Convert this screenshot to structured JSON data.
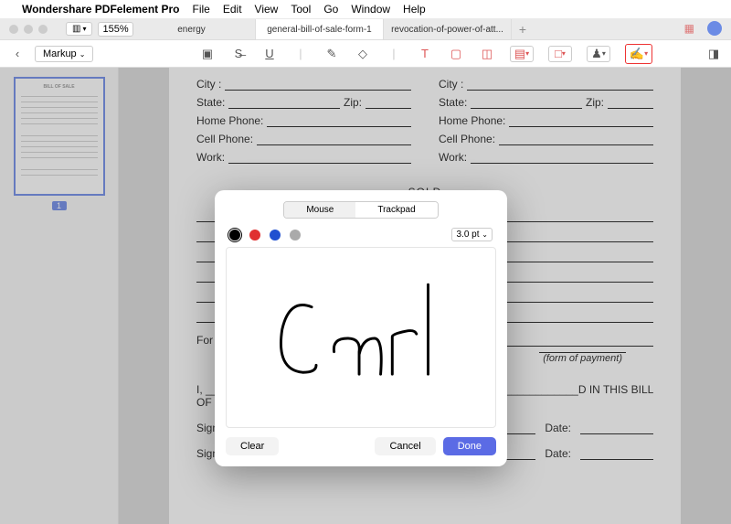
{
  "menubar": {
    "app": "Wondershare PDFelement Pro",
    "items": [
      "File",
      "Edit",
      "View",
      "Tool",
      "Go",
      "Window",
      "Help"
    ]
  },
  "titlebar": {
    "zoom": "155%"
  },
  "tabs": {
    "items": [
      "energy",
      "general-bill-of-sale-form-1",
      "revocation-of-power-of-att..."
    ],
    "active_index": 1
  },
  "toolbar": {
    "markup_label": "Markup"
  },
  "thumbnails": {
    "page_num": "1"
  },
  "form": {
    "city": "City :",
    "state": "State:",
    "zip": "Zip:",
    "home_phone": "Home Phone:",
    "cell_phone": "Cell Phone:",
    "work": "Work:",
    "sold_header": "SOLD",
    "for_label": "For",
    "form_of_payment": "(form of payment)",
    "paragraph": "I, ________________ THE SELLER OF THE ITEM D____________________D IN THIS BILL OF SALE IS",
    "sig_seller": "Signature of Seller:",
    "sig_buyer": "Signature of Buyer:",
    "date": "Date:"
  },
  "dialog": {
    "tab_mouse": "Mouse",
    "tab_trackpad": "Trackpad",
    "stroke": "3.0 pt",
    "clear": "Clear",
    "cancel": "Cancel",
    "done": "Done",
    "signature_text": "Carl"
  }
}
